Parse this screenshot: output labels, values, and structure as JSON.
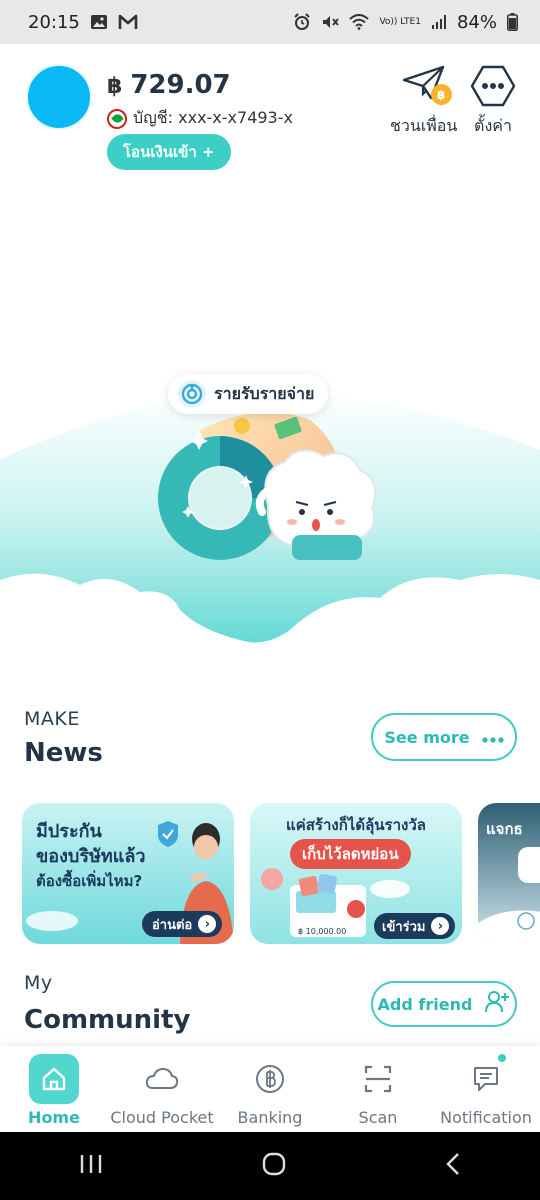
{
  "status_bar": {
    "time": "20:15",
    "battery": "84%",
    "network_label": "Vo)) LTE1"
  },
  "header": {
    "currency_symbol": "฿",
    "balance": "729.07",
    "account_label": "บัญชี: xxx-x-x7493-x",
    "topup_label": "โอนเงินเข้า +",
    "invite_label": "ชวนเพื่อน",
    "settings_label": "ตั้งค่า",
    "avatar_color": "#0ab8f5"
  },
  "hero": {
    "pill_label": "รายรับรายจ่าย"
  },
  "news": {
    "kicker": "MAKE",
    "title": "News",
    "see_more_label": "See more",
    "banners": [
      {
        "line1": "มีประกัน",
        "line2": "ของบริษัทแล้ว",
        "line3": "ต้องซื้อเพิ่มไหม?",
        "cta": "อ่านต่อ"
      },
      {
        "headline": "แค่สร้างก็ได้ลุ้นรางวัล",
        "tag": "เก็บไว้ลดหย่อน",
        "card_amount": "฿ 10,000.00",
        "cta": "เข้าร่วม"
      },
      {
        "headline": "แจกธ"
      }
    ]
  },
  "community": {
    "kicker": "My",
    "title": "Community",
    "add_friend_label": "Add friend"
  },
  "bottom_nav": {
    "items": [
      {
        "label": "Home",
        "icon": "home-icon",
        "active": true
      },
      {
        "label": "Cloud Pocket",
        "icon": "cloud-icon",
        "active": false
      },
      {
        "label": "Banking",
        "icon": "baht-icon",
        "active": false
      },
      {
        "label": "Scan",
        "icon": "scan-icon",
        "active": false
      },
      {
        "label": "Notification",
        "icon": "chat-icon",
        "active": false
      }
    ]
  },
  "colors": {
    "accent": "#3ccfc7",
    "navy": "#243447",
    "hero_teal": "#4dd3cf"
  }
}
